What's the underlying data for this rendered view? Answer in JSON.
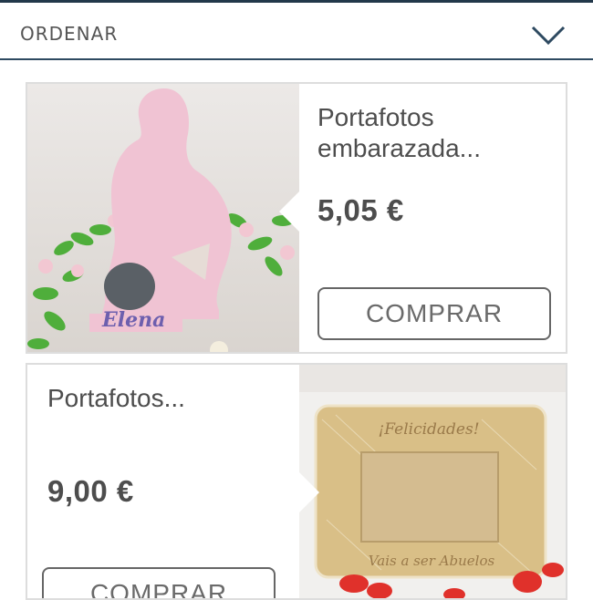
{
  "sort_bar": {
    "label": "ORDENAR",
    "icon": "chevron-down-icon"
  },
  "products": [
    {
      "title_line1": "Portafotos",
      "title_line2": "embarazada...",
      "price": "5,05 €",
      "buy_label": "COMPRAR",
      "image_text": "Elena"
    },
    {
      "title_line1": "Portafotos...",
      "price": "9,00 €",
      "buy_label": "COMPRAR",
      "image_text_top": "¡Felicidades!",
      "image_text_bottom": "Vais a ser Abuelos"
    }
  ],
  "colors": {
    "accent": "#2e4a61",
    "border": "#dddddd",
    "text": "#4d4d4d"
  }
}
